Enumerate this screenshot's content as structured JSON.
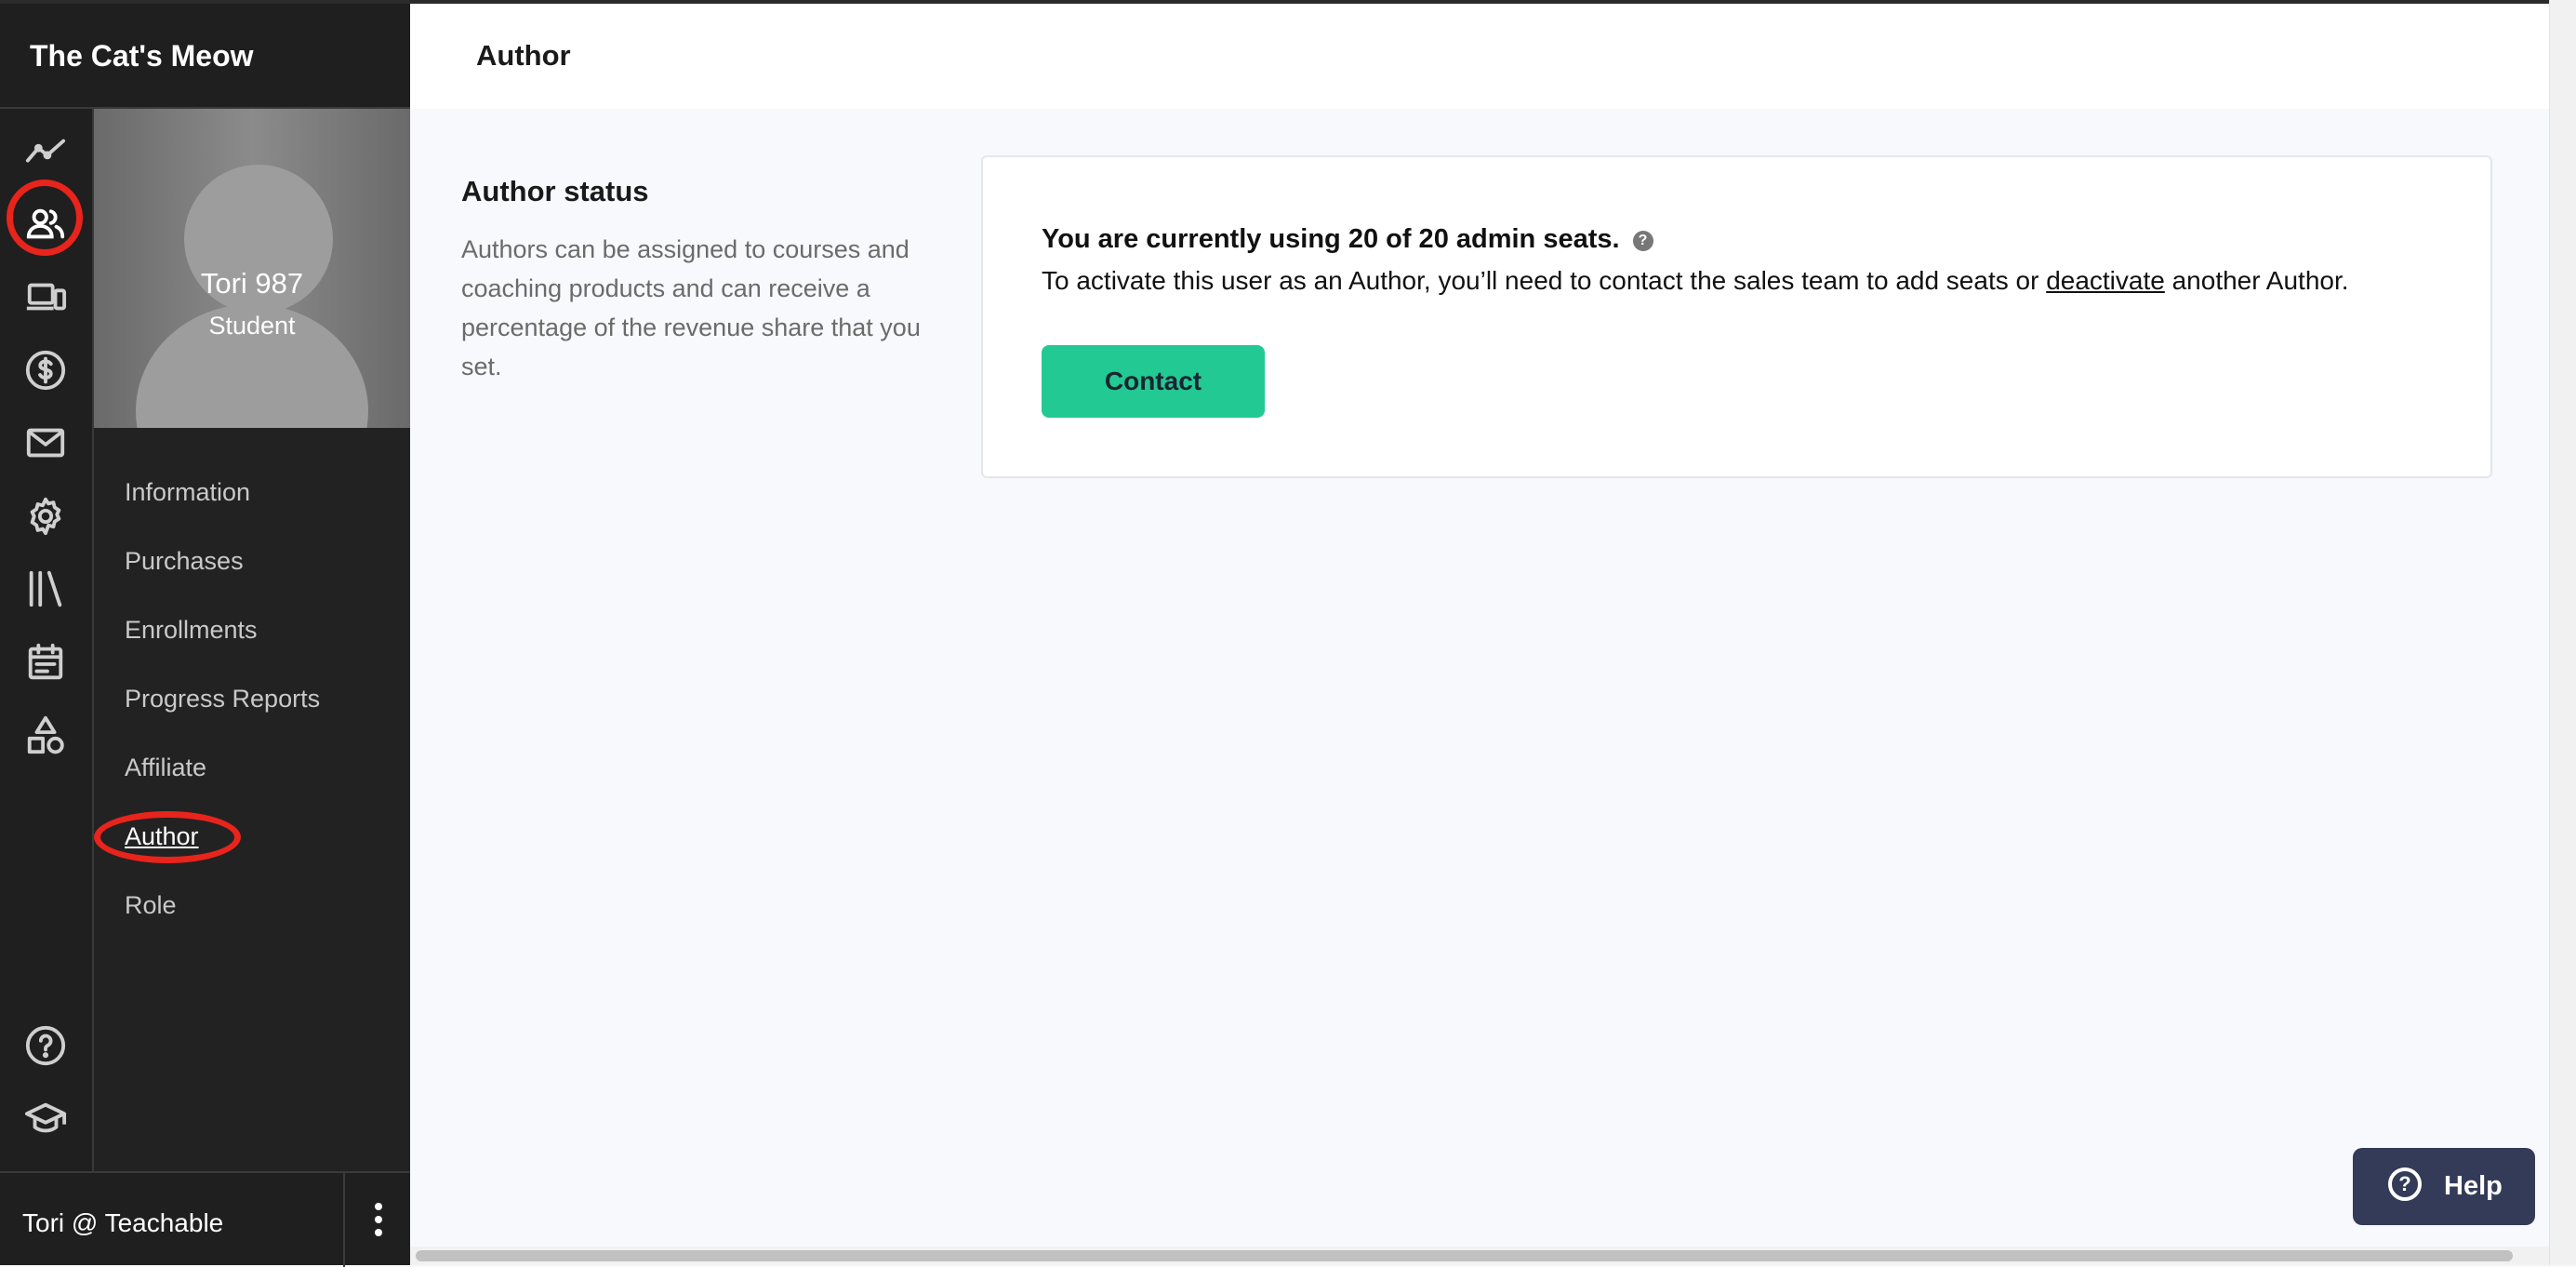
{
  "app": {
    "title": "The Cat's Meow"
  },
  "rail": {
    "icons": [
      "analytics-icon",
      "users-icon",
      "devices-icon",
      "dollar-icon",
      "mail-icon",
      "gear-icon",
      "library-icon",
      "calendar-icon",
      "shapes-icon",
      "help-icon",
      "graduation-cap-icon"
    ],
    "active": "users-icon"
  },
  "profile": {
    "name": "Tori 987",
    "role": "Student"
  },
  "subnav": {
    "items": [
      {
        "label": "Information"
      },
      {
        "label": "Purchases"
      },
      {
        "label": "Enrollments"
      },
      {
        "label": "Progress Reports"
      },
      {
        "label": "Affiliate"
      },
      {
        "label": "Author"
      },
      {
        "label": "Role"
      }
    ],
    "active": "Author"
  },
  "user": {
    "name": "Tori @ Teachable"
  },
  "main": {
    "title": "Author",
    "section": {
      "title": "Author status",
      "description": "Authors can be assigned to courses and coaching products and can receive a percentage of the revenue share that you set."
    },
    "card": {
      "seats_text": "You are currently using 20 of 20 admin seats.",
      "help_glyph": "?",
      "activate_prefix": "To activate this user as an Author, you’ll need to contact the sales team to add seats or ",
      "activate_link": "deactivate",
      "activate_suffix": " another Author.",
      "contact_label": "Contact"
    }
  },
  "help_widget": {
    "glyph": "?",
    "label": "Help"
  },
  "colors": {
    "accent": "#22c993",
    "sidebar": "#1f1f1f",
    "highlight": "#e8241c",
    "help": "#343b58"
  }
}
